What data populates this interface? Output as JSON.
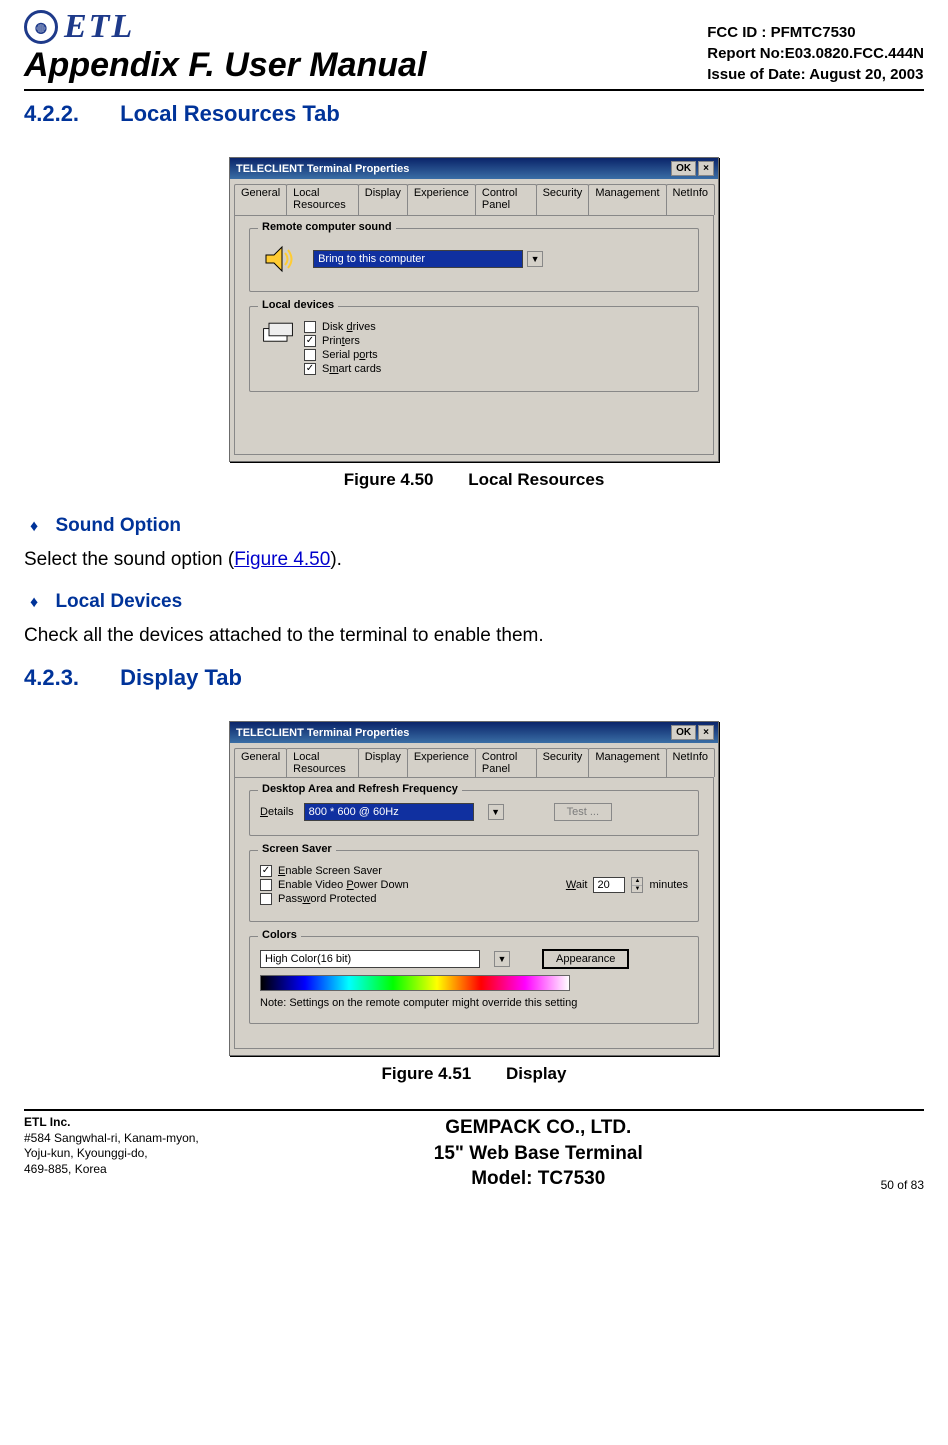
{
  "header": {
    "logo_text": "ETL",
    "appendix_title": "Appendix F. User Manual",
    "fcc_id": "FCC ID : PFMTC7530",
    "report_no": "Report No:E03.0820.FCC.444N",
    "issue_date": "Issue of Date:  August 20, 2003"
  },
  "sec1": {
    "num": "4.2.2.",
    "title": "Local Resources Tab"
  },
  "fig1": {
    "caption_num": "Figure 4.50",
    "caption_title": "Local Resources",
    "dlg_title": "TELECLIENT Terminal Properties",
    "ok": "OK",
    "close_x": "×",
    "tabs": [
      "General",
      "Local Resources",
      "Display",
      "Experience",
      "Control Panel",
      "Security",
      "Management",
      "NetInfo"
    ],
    "grp_sound": "Remote computer sound",
    "sound_value": "Bring to this computer",
    "grp_local": "Local devices",
    "devices": [
      {
        "label_pre": "Disk ",
        "u": "d",
        "label_post": "rives",
        "checked": false
      },
      {
        "label_pre": "Prin",
        "u": "t",
        "label_post": "ers",
        "checked": true
      },
      {
        "label_pre": "Serial p",
        "u": "o",
        "label_post": "rts",
        "checked": false
      },
      {
        "label_pre": "S",
        "u": "m",
        "label_post": "art cards",
        "checked": true
      }
    ]
  },
  "bullets": {
    "b1_title": "Sound Option",
    "b1_text_pre": "Select the sound option (",
    "b1_link": "Figure 4.50",
    "b1_text_post": ").",
    "b2_title": "Local Devices",
    "b2_text": "Check all the devices attached to the terminal to enable them."
  },
  "sec2": {
    "num": "4.2.3.",
    "title": "Display Tab"
  },
  "fig2": {
    "caption_num": "Figure 4.51",
    "caption_title": "Display",
    "dlg_title": "TELECLIENT Terminal Properties",
    "ok": "OK",
    "close_x": "×",
    "tabs": [
      "General",
      "Local Resources",
      "Display",
      "Experience",
      "Control Panel",
      "Security",
      "Management",
      "NetInfo"
    ],
    "grp_desktop": "Desktop Area and Refresh Frequency",
    "details_label_u": "D",
    "details_label_post": "etails",
    "details_value": "800 * 600 @ 60Hz",
    "test_btn": "Test ...",
    "grp_saver": "Screen Saver",
    "ss_items": [
      {
        "pre": "",
        "u": "E",
        "post": "nable Screen Saver",
        "checked": true
      },
      {
        "pre": "Enable Video ",
        "u": "P",
        "post": "ower Down",
        "checked": false
      },
      {
        "pre": "Pass",
        "u": "w",
        "post": "ord Protected",
        "checked": false
      }
    ],
    "wait_u": "W",
    "wait_post": "ait",
    "wait_value": "20",
    "wait_unit": "minutes",
    "grp_colors": "Colors",
    "colors_value": "High Color(16 bit)",
    "appearance_btn": "Appearance",
    "colors_note": "Note: Settings on the remote computer might override this setting"
  },
  "footer": {
    "company": "ETL Inc.",
    "addr1": "#584 Sangwhal-ri, Kanam-myon,",
    "addr2": "Yoju-kun, Kyounggi-do,",
    "addr3": "469-885, Korea",
    "c1": "GEMPACK CO., LTD.",
    "c2": "15\" Web Base Terminal",
    "c3": "Model: TC7530",
    "pg": "50 of  83"
  }
}
